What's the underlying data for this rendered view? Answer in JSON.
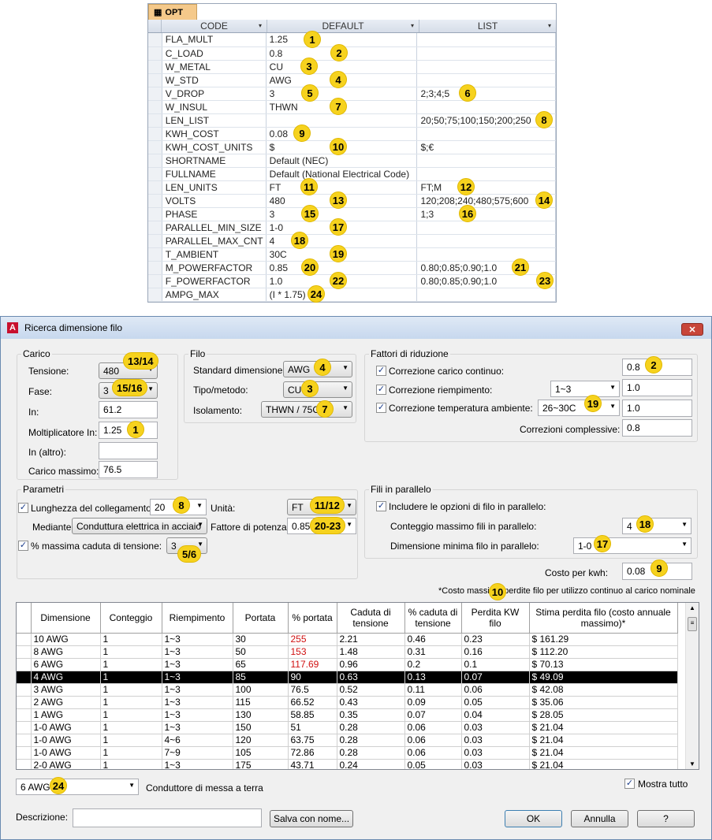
{
  "opt": {
    "tab": "OPT",
    "headers": [
      "CODE",
      "DEFAULT",
      "LIST"
    ],
    "rows": [
      [
        "FLA_MULT",
        "1.25",
        ""
      ],
      [
        "C_LOAD",
        "0.8",
        ""
      ],
      [
        "W_METAL",
        "CU",
        ""
      ],
      [
        "W_STD",
        "AWG",
        ""
      ],
      [
        "V_DROP",
        "3",
        "2;3;4;5"
      ],
      [
        "W_INSUL",
        "THWN",
        ""
      ],
      [
        "LEN_LIST",
        "",
        "20;50;75;100;150;200;250"
      ],
      [
        "KWH_COST",
        "0.08",
        ""
      ],
      [
        "KWH_COST_UNITS",
        "$",
        "$;€"
      ],
      [
        "SHORTNAME",
        "Default (NEC)",
        ""
      ],
      [
        "FULLNAME",
        "Default (National Electrical Code)",
        ""
      ],
      [
        "LEN_UNITS",
        "FT",
        "FT;M"
      ],
      [
        "VOLTS",
        "480",
        "120;208;240;480;575;600"
      ],
      [
        "PHASE",
        "3",
        "1;3"
      ],
      [
        "PARALLEL_MIN_SIZE",
        "1-0",
        ""
      ],
      [
        "PARALLEL_MAX_CNT",
        "4",
        ""
      ],
      [
        "T_AMBIENT",
        "30C",
        ""
      ],
      [
        "M_POWERFACTOR",
        "0.85",
        "0.80;0.85;0.90;1.0"
      ],
      [
        "F_POWERFACTOR",
        "1.0",
        "0.80;0.85;0.90;1.0"
      ],
      [
        "AMPG_MAX",
        "(I * 1.75)",
        ""
      ]
    ],
    "badges": [
      "1",
      "2",
      "3",
      "4",
      "5",
      "6",
      "7",
      "8",
      "9",
      "10",
      "11",
      "12",
      "13",
      "14",
      "15",
      "16",
      "17",
      "18",
      "19",
      "20",
      "21",
      "22",
      "23",
      "24"
    ]
  },
  "dialog": {
    "title": "Ricerca dimensione filo",
    "close": "✕",
    "carico": {
      "label": "Carico",
      "tensione_label": "Tensione:",
      "tensione": "480",
      "fase_label": "Fase:",
      "fase": "3",
      "in_label": "In:",
      "in": "61.2",
      "molt_label": "Moltiplicatore In:",
      "molt": "1.25",
      "in_altro_label": "In (altro):",
      "in_altro": "",
      "carico_max_label": "Carico massimo:",
      "carico_max": "76.5",
      "b_tensione": "13/14",
      "b_fase": "15/16",
      "b_molt": "1"
    },
    "filo": {
      "label": "Filo",
      "std_label": "Standard dimensione:",
      "std": "AWG",
      "tipo_label": "Tipo/metodo:",
      "tipo": "CU",
      "iso_label": "Isolamento:",
      "iso": "THWN / 75C",
      "b_std": "4",
      "b_tipo": "3",
      "b_iso": "7"
    },
    "fattori": {
      "label": "Fattori di riduzione",
      "c1_label": "Correzione carico continuo:",
      "c1": "0.8",
      "c2_label": "Correzione riempimento:",
      "c2_sel": "1~3",
      "c2": "1.0",
      "c3_label": "Correzione temperatura ambiente:",
      "c3_sel": "26~30C",
      "c3": "1.0",
      "comp_label": "Correzioni complessive:",
      "comp": "0.8",
      "b_c1": "2",
      "b_c3": "19"
    },
    "parametri": {
      "label": "Parametri",
      "lung_label": "Lunghezza del collegamento:",
      "lung": "20",
      "unita_label": "Unità:",
      "unita": "FT",
      "mediante_label": "Mediante:",
      "mediante": "Conduttura elettrica in acciaio",
      "fattore_label": "Fattore di potenza:",
      "fattore": "0.85",
      "caduta_label": "% massima caduta di tensione:",
      "caduta": "3",
      "b_lung": "8",
      "b_unita": "11/12",
      "b_fattore": "20-23",
      "b_caduta": "5/6"
    },
    "parallelo": {
      "label": "Fili in parallelo",
      "includere_label": "Includere le opzioni di filo in parallelo:",
      "conteggio_label": "Conteggio massimo fili in parallelo:",
      "conteggio": "4",
      "dimmin_label": "Dimensione minima filo in parallelo:",
      "dimmin": "1-0",
      "b_conteggio": "18",
      "b_dimmin": "17"
    },
    "costo_label": "Costo per kwh:",
    "costo": "0.08",
    "b_costo": "9",
    "note": "*Costo massimo perdite filo per utilizzo continuo al carico nominale",
    "b_note": "10",
    "grid": {
      "headers": [
        "Dimensione",
        "Conteggio",
        "Riempimento",
        "Portata",
        "% portata",
        "Caduta di tensione",
        "% caduta di tensione",
        "Perdita KW filo",
        "Stima perdita filo (costo annuale massimo)*"
      ],
      "rows": [
        [
          "10 AWG",
          "1",
          "1~3",
          "30",
          "255",
          "2.21",
          "0.46",
          "0.23",
          "$ 161.29"
        ],
        [
          "8 AWG",
          "1",
          "1~3",
          "50",
          "153",
          "1.48",
          "0.31",
          "0.16",
          "$ 112.20"
        ],
        [
          "6 AWG",
          "1",
          "1~3",
          "65",
          "117.69",
          "0.96",
          "0.2",
          "0.1",
          "$ 70.13"
        ],
        [
          "4 AWG",
          "1",
          "1~3",
          "85",
          "90",
          "0.63",
          "0.13",
          "0.07",
          "$ 49.09"
        ],
        [
          "3 AWG",
          "1",
          "1~3",
          "100",
          "76.5",
          "0.52",
          "0.11",
          "0.06",
          "$ 42.08"
        ],
        [
          "2 AWG",
          "1",
          "1~3",
          "115",
          "66.52",
          "0.43",
          "0.09",
          "0.05",
          "$ 35.06"
        ],
        [
          "1 AWG",
          "1",
          "1~3",
          "130",
          "58.85",
          "0.35",
          "0.07",
          "0.04",
          "$ 28.05"
        ],
        [
          "1-0 AWG",
          "1",
          "1~3",
          "150",
          "51",
          "0.28",
          "0.06",
          "0.03",
          "$ 21.04"
        ],
        [
          "1-0 AWG",
          "1",
          "4~6",
          "120",
          "63.75",
          "0.28",
          "0.06",
          "0.03",
          "$ 21.04"
        ],
        [
          "1-0 AWG",
          "1",
          "7~9",
          "105",
          "72.86",
          "0.28",
          "0.06",
          "0.03",
          "$ 21.04"
        ],
        [
          "2-0 AWG",
          "1",
          "1~3",
          "175",
          "43.71",
          "0.24",
          "0.05",
          "0.03",
          "$ 21.04"
        ]
      ],
      "selected_index": 3,
      "red_rows": [
        0,
        1,
        2
      ]
    },
    "terra": "6 AWG",
    "terra_label": "Conduttore di messa a terra",
    "b_terra": "24",
    "mostra_label": "Mostra tutto",
    "descr_label": "Descrizione:",
    "descr": "",
    "salva": "Salva con nome...",
    "ok": "OK",
    "annulla": "Annulla",
    "help": "?"
  }
}
